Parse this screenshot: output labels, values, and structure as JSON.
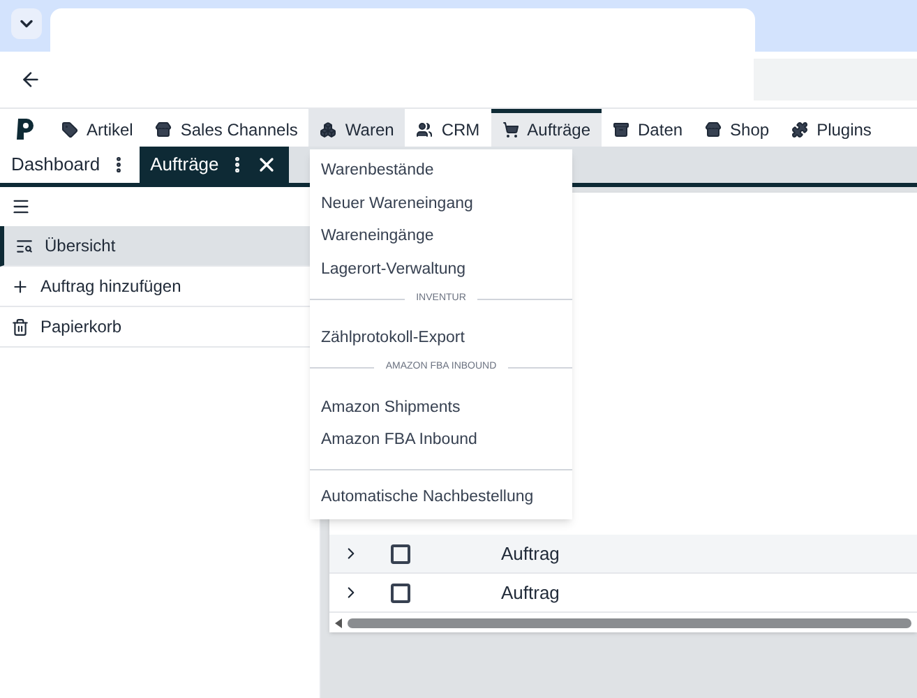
{
  "nav": [
    {
      "label": "Artikel",
      "selected": false,
      "open": false
    },
    {
      "label": "Sales Channels",
      "selected": false,
      "open": false
    },
    {
      "label": "Waren",
      "selected": false,
      "open": true
    },
    {
      "label": "CRM",
      "selected": false,
      "open": false
    },
    {
      "label": "Aufträge",
      "selected": true,
      "open": false
    },
    {
      "label": "Daten",
      "selected": false,
      "open": false
    },
    {
      "label": "Shop",
      "selected": false,
      "open": false
    },
    {
      "label": "Plugins",
      "selected": false,
      "open": false
    }
  ],
  "tabs": [
    {
      "label": "Dashboard",
      "selected": false
    },
    {
      "label": "Aufträge",
      "selected": true
    }
  ],
  "sidebar": {
    "items": [
      {
        "label": "Übersicht",
        "selected": true
      },
      {
        "label": "Auftrag hinzufügen",
        "selected": false
      },
      {
        "label": "Papierkorb",
        "selected": false
      }
    ]
  },
  "menu": [
    {
      "kind": "item",
      "label": "Warenbestände"
    },
    {
      "kind": "item",
      "label": "Neuer Wareneingang"
    },
    {
      "kind": "item",
      "label": "Wareneingänge"
    },
    {
      "kind": "item",
      "label": "Lagerort-Verwaltung"
    },
    {
      "kind": "section",
      "label": "INVENTUR"
    },
    {
      "kind": "item",
      "label": "Zählprotokoll-Export"
    },
    {
      "kind": "section",
      "label": "AMAZON FBA INBOUND"
    },
    {
      "kind": "item",
      "label": "Amazon Shipments"
    },
    {
      "kind": "item",
      "label": "Amazon FBA Inbound"
    },
    {
      "kind": "divider"
    },
    {
      "kind": "item",
      "label": "Automatische Nachbestellung"
    }
  ],
  "table": {
    "rows": [
      {
        "label": "Auftrag",
        "checked": false
      },
      {
        "label": "Auftrag",
        "checked": false
      }
    ]
  }
}
